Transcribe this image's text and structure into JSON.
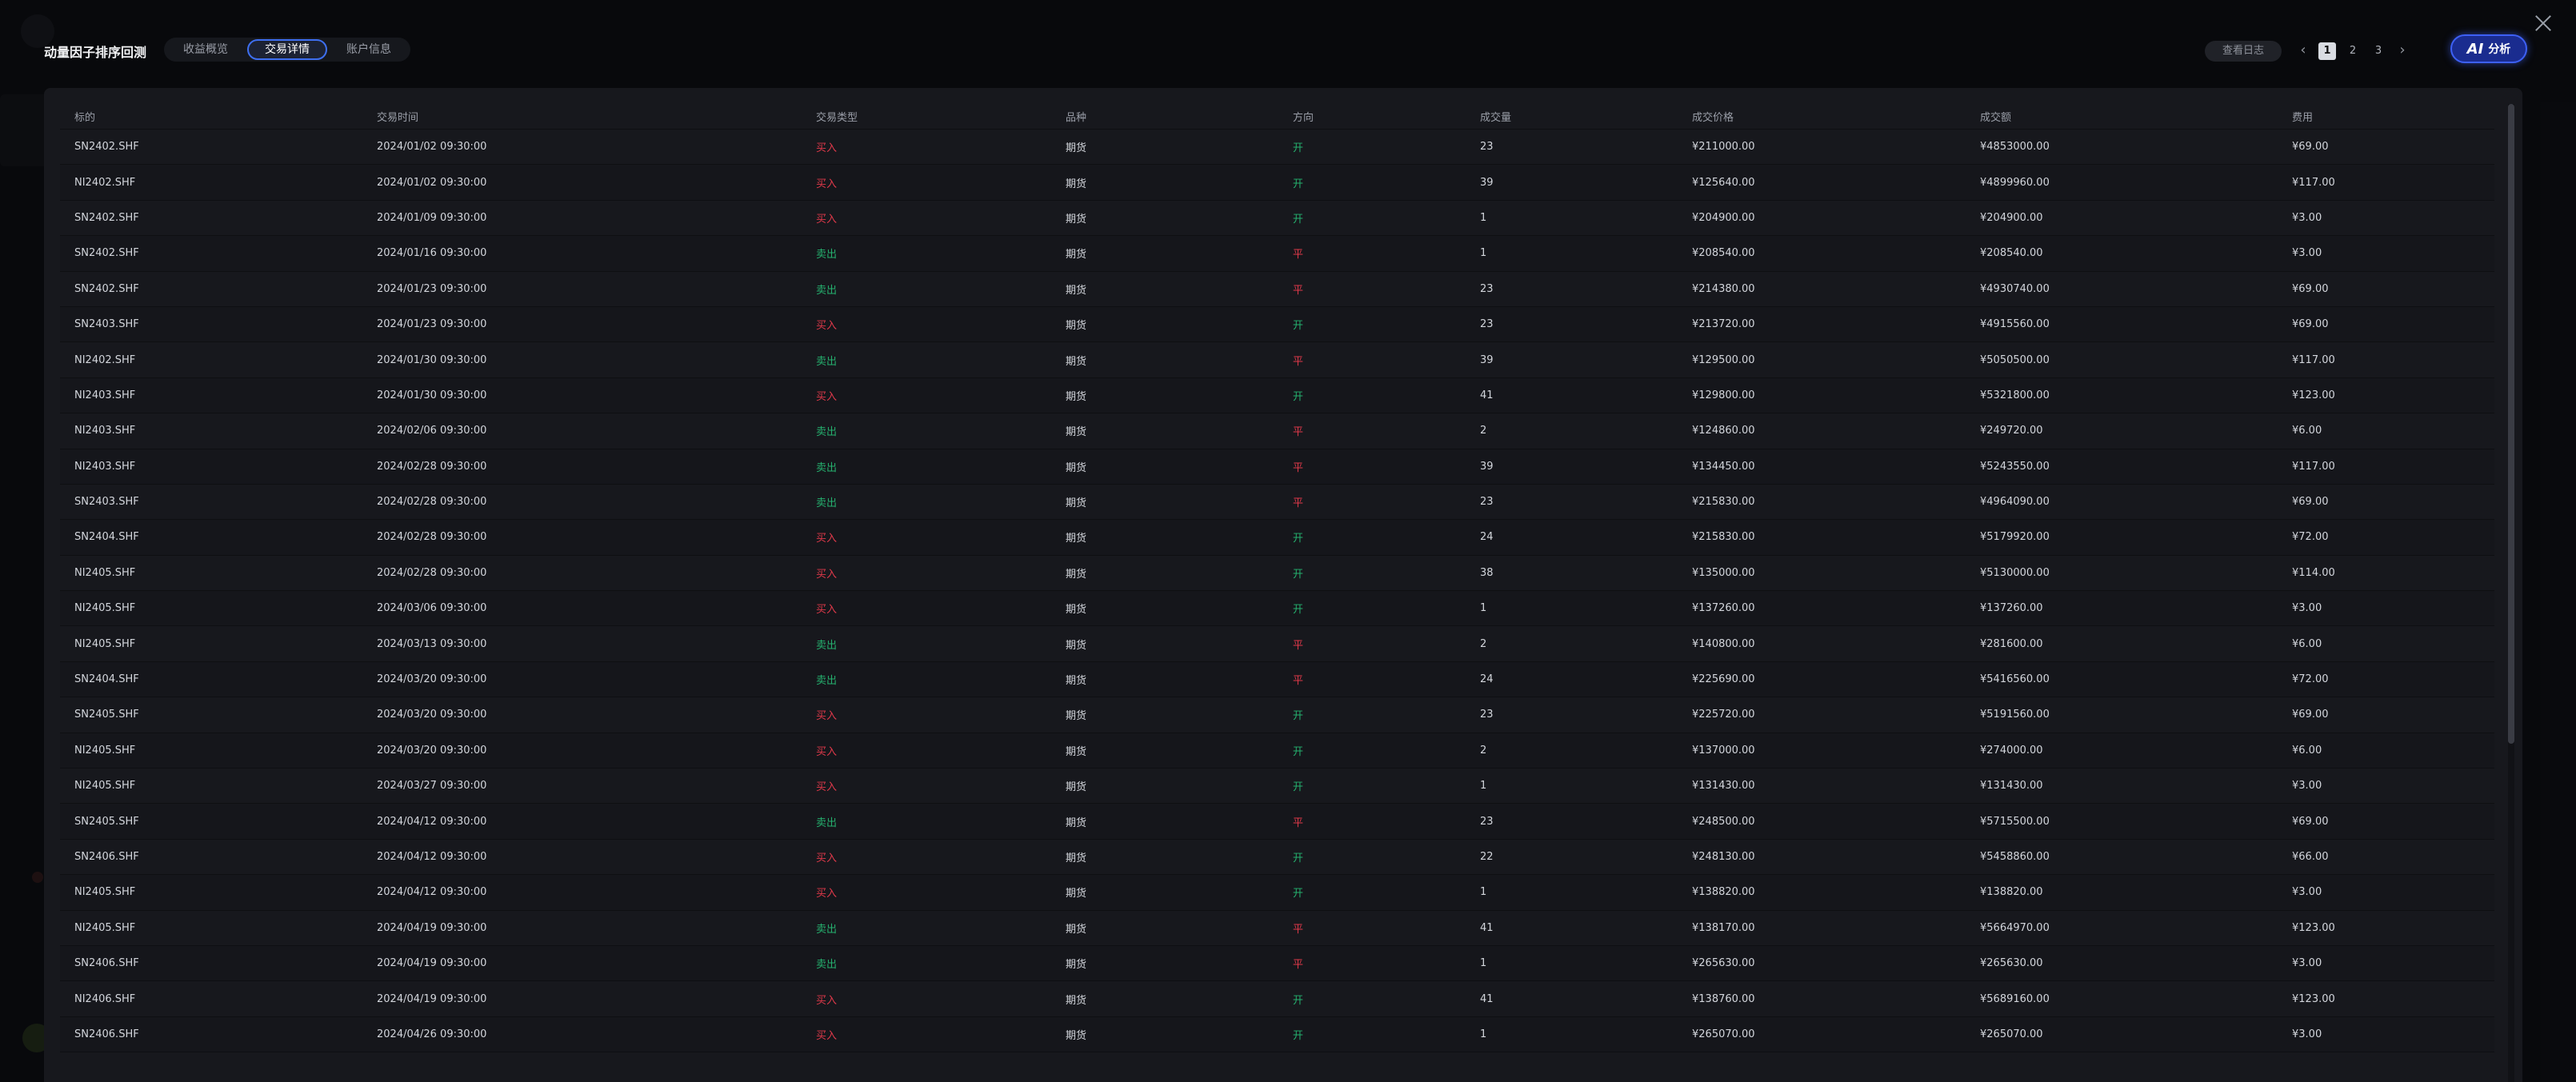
{
  "modal": {
    "title": "动量因子排序回测",
    "tabs": [
      "收益概览",
      "交易详情",
      "账户信息"
    ],
    "active_tab": "交易详情",
    "log_button": "查看日志",
    "pagination": {
      "pages": [
        "1",
        "2",
        "3"
      ],
      "current": "1",
      "prev_icon": "‹",
      "next_icon": "›"
    },
    "ai_button": {
      "icon": "AI",
      "label": "分析"
    }
  },
  "table": {
    "headers": [
      "标的",
      "交易时间",
      "交易类型",
      "品种",
      "方向",
      "成交量",
      "成交价格",
      "成交额",
      "费用"
    ],
    "rows": [
      [
        "SN2402.SHF",
        "2024/01/02 09:30:00",
        "买入",
        "期货",
        "开",
        "23",
        "¥211000.00",
        "¥4853000.00",
        "¥69.00"
      ],
      [
        "NI2402.SHF",
        "2024/01/02 09:30:00",
        "买入",
        "期货",
        "开",
        "39",
        "¥125640.00",
        "¥4899960.00",
        "¥117.00"
      ],
      [
        "SN2402.SHF",
        "2024/01/09 09:30:00",
        "买入",
        "期货",
        "开",
        "1",
        "¥204900.00",
        "¥204900.00",
        "¥3.00"
      ],
      [
        "SN2402.SHF",
        "2024/01/16 09:30:00",
        "卖出",
        "期货",
        "平",
        "1",
        "¥208540.00",
        "¥208540.00",
        "¥3.00"
      ],
      [
        "SN2402.SHF",
        "2024/01/23 09:30:00",
        "卖出",
        "期货",
        "平",
        "23",
        "¥214380.00",
        "¥4930740.00",
        "¥69.00"
      ],
      [
        "SN2403.SHF",
        "2024/01/23 09:30:00",
        "买入",
        "期货",
        "开",
        "23",
        "¥213720.00",
        "¥4915560.00",
        "¥69.00"
      ],
      [
        "NI2402.SHF",
        "2024/01/30 09:30:00",
        "卖出",
        "期货",
        "平",
        "39",
        "¥129500.00",
        "¥5050500.00",
        "¥117.00"
      ],
      [
        "NI2403.SHF",
        "2024/01/30 09:30:00",
        "买入",
        "期货",
        "开",
        "41",
        "¥129800.00",
        "¥5321800.00",
        "¥123.00"
      ],
      [
        "NI2403.SHF",
        "2024/02/06 09:30:00",
        "卖出",
        "期货",
        "平",
        "2",
        "¥124860.00",
        "¥249720.00",
        "¥6.00"
      ],
      [
        "NI2403.SHF",
        "2024/02/28 09:30:00",
        "卖出",
        "期货",
        "平",
        "39",
        "¥134450.00",
        "¥5243550.00",
        "¥117.00"
      ],
      [
        "SN2403.SHF",
        "2024/02/28 09:30:00",
        "卖出",
        "期货",
        "平",
        "23",
        "¥215830.00",
        "¥4964090.00",
        "¥69.00"
      ],
      [
        "SN2404.SHF",
        "2024/02/28 09:30:00",
        "买入",
        "期货",
        "开",
        "24",
        "¥215830.00",
        "¥5179920.00",
        "¥72.00"
      ],
      [
        "NI2405.SHF",
        "2024/02/28 09:30:00",
        "买入",
        "期货",
        "开",
        "38",
        "¥135000.00",
        "¥5130000.00",
        "¥114.00"
      ],
      [
        "NI2405.SHF",
        "2024/03/06 09:30:00",
        "买入",
        "期货",
        "开",
        "1",
        "¥137260.00",
        "¥137260.00",
        "¥3.00"
      ],
      [
        "NI2405.SHF",
        "2024/03/13 09:30:00",
        "卖出",
        "期货",
        "平",
        "2",
        "¥140800.00",
        "¥281600.00",
        "¥6.00"
      ],
      [
        "SN2404.SHF",
        "2024/03/20 09:30:00",
        "卖出",
        "期货",
        "平",
        "24",
        "¥225690.00",
        "¥5416560.00",
        "¥72.00"
      ],
      [
        "SN2405.SHF",
        "2024/03/20 09:30:00",
        "买入",
        "期货",
        "开",
        "23",
        "¥225720.00",
        "¥5191560.00",
        "¥69.00"
      ],
      [
        "NI2405.SHF",
        "2024/03/20 09:30:00",
        "买入",
        "期货",
        "开",
        "2",
        "¥137000.00",
        "¥274000.00",
        "¥6.00"
      ],
      [
        "NI2405.SHF",
        "2024/03/27 09:30:00",
        "买入",
        "期货",
        "开",
        "1",
        "¥131430.00",
        "¥131430.00",
        "¥3.00"
      ],
      [
        "SN2405.SHF",
        "2024/04/12 09:30:00",
        "卖出",
        "期货",
        "平",
        "23",
        "¥248500.00",
        "¥5715500.00",
        "¥69.00"
      ],
      [
        "SN2406.SHF",
        "2024/04/12 09:30:00",
        "买入",
        "期货",
        "开",
        "22",
        "¥248130.00",
        "¥5458860.00",
        "¥66.00"
      ],
      [
        "NI2405.SHF",
        "2024/04/12 09:30:00",
        "买入",
        "期货",
        "开",
        "1",
        "¥138820.00",
        "¥138820.00",
        "¥3.00"
      ],
      [
        "NI2405.SHF",
        "2024/04/19 09:30:00",
        "卖出",
        "期货",
        "平",
        "41",
        "¥138170.00",
        "¥5664970.00",
        "¥123.00"
      ],
      [
        "SN2406.SHF",
        "2024/04/19 09:30:00",
        "卖出",
        "期货",
        "平",
        "1",
        "¥265630.00",
        "¥265630.00",
        "¥3.00"
      ],
      [
        "NI2406.SHF",
        "2024/04/19 09:30:00",
        "买入",
        "期货",
        "开",
        "41",
        "¥138760.00",
        "¥5689160.00",
        "¥123.00"
      ],
      [
        "SN2406.SHF",
        "2024/04/26 09:30:00",
        "买入",
        "期货",
        "开",
        "1",
        "¥265070.00",
        "¥265070.00",
        "¥3.00"
      ]
    ]
  },
  "colors": {
    "buy": "#e0394a",
    "sell": "#25b06e",
    "accent": "#3e6ff0",
    "ai": "#1a2c8f"
  }
}
